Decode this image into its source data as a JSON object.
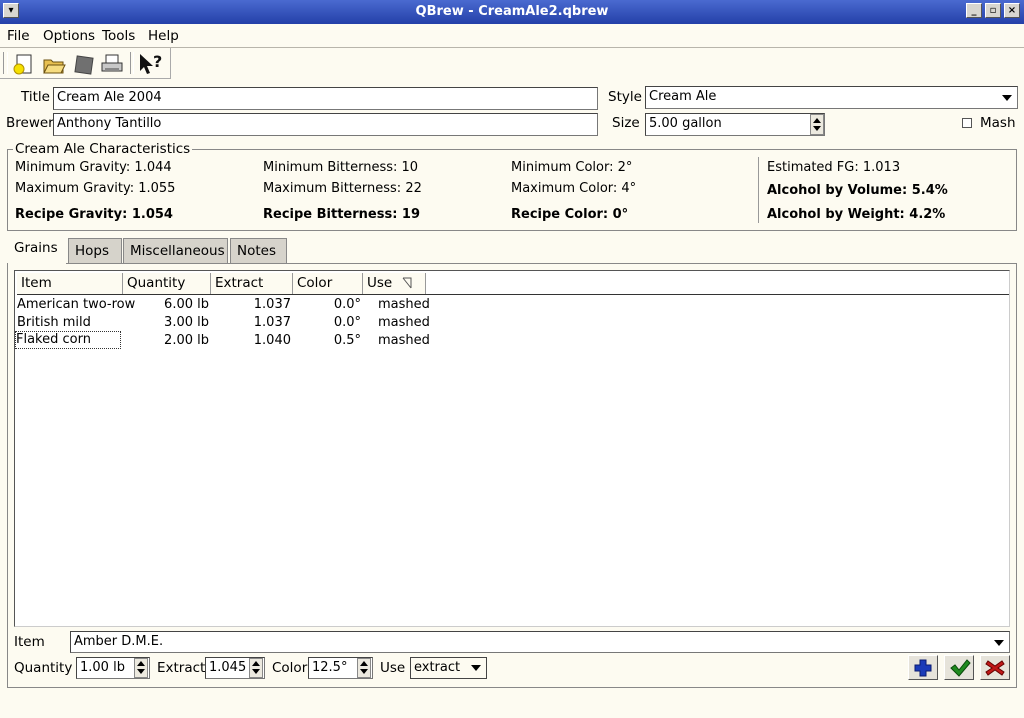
{
  "window": {
    "title": "QBrew - CreamAle2.qbrew"
  },
  "menubar": [
    {
      "label": "File"
    },
    {
      "label": "Options"
    },
    {
      "label": "Tools"
    },
    {
      "label": "Help"
    }
  ],
  "toolbar": {
    "icons": [
      "new-file-icon",
      "open-folder-icon",
      "save-disk-icon",
      "print-icon",
      "whats-this-help-icon"
    ]
  },
  "recipe": {
    "title_label": "Title",
    "title_value": "Cream Ale 2004",
    "brewer_label": "Brewer",
    "brewer_value": "Anthony Tantillo",
    "style_label": "Style",
    "style_value": "Cream Ale",
    "size_label": "Size",
    "size_value": "5.00 gallon",
    "mash_label": "Mash",
    "mash_checked": false
  },
  "characteristics": {
    "title": "Cream Ale Characteristics",
    "min_gravity": "Minimum Gravity: 1.044",
    "max_gravity": "Maximum Gravity: 1.055",
    "recipe_gravity": "Recipe Gravity: 1.054",
    "min_bitterness": "Minimum Bitterness: 10",
    "max_bitterness": "Maximum Bitterness: 22",
    "recipe_bitterness": "Recipe Bitterness: 19",
    "min_color": "Minimum Color: 2°",
    "max_color": "Maximum Color: 4°",
    "recipe_color": "Recipe Color: 0°",
    "est_fg": "Estimated FG: 1.013",
    "abv": "Alcohol by Volume: 5.4%",
    "abw": "Alcohol by Weight: 4.2%"
  },
  "tabs": [
    {
      "label": "Grains",
      "active": true
    },
    {
      "label": "Hops"
    },
    {
      "label": "Miscellaneous"
    },
    {
      "label": "Notes"
    }
  ],
  "grains": {
    "columns": [
      "Item",
      "Quantity",
      "Extract",
      "Color",
      "Use"
    ],
    "rows": [
      {
        "item": "American two-row",
        "quantity": "6.00 lb",
        "extract": "1.037",
        "color": "0.0°",
        "use": "mashed"
      },
      {
        "item": "British mild",
        "quantity": "3.00 lb",
        "extract": "1.037",
        "color": "0.0°",
        "use": "mashed"
      },
      {
        "item": "Flaked corn",
        "quantity": "2.00 lb",
        "extract": "1.040",
        "color": "0.5°",
        "use": "mashed"
      }
    ]
  },
  "editor": {
    "item_label": "Item",
    "item_value": "Amber D.M.E.",
    "quantity_label": "Quantity",
    "quantity_value": "1.00 lb",
    "extract_label": "Extract",
    "extract_value": "1.045",
    "color_label": "Color",
    "color_value": "12.5°",
    "use_label": "Use",
    "use_value": "extract"
  },
  "actions": [
    "add-icon",
    "apply-icon",
    "remove-icon"
  ],
  "colors": {
    "titlebar": "#2440a8",
    "add": "#1a3ab8",
    "apply": "#1f8a1f",
    "remove": "#c01818"
  }
}
